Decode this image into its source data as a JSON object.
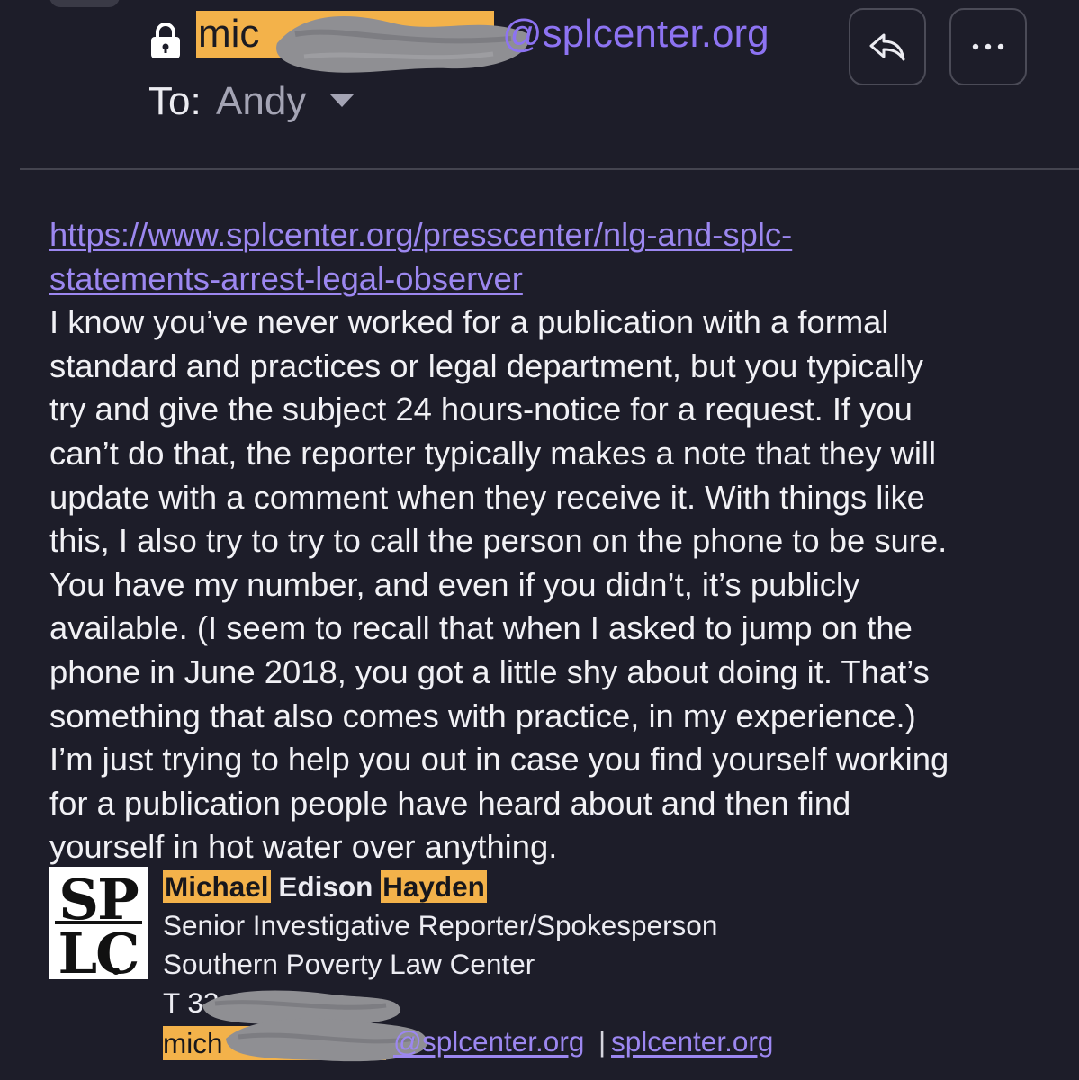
{
  "header": {
    "sender_prefix": "mic",
    "sender_domain": "@splcenter.org",
    "to_label": "To:",
    "to_name": "Andy",
    "reply_icon": "reply-arrow-icon",
    "more_icon": "ellipsis-icon",
    "lock_icon": "lock-icon"
  },
  "body": {
    "link_line1": "https://www.splcenter.org/presscenter/nlg-and-splc-",
    "link_line2": "statements-arrest-legal-observer",
    "lines": [
      "I know you’ve never worked for a publication with a formal",
      "standard and practices or legal department, but you typically",
      "try and give the subject 24 hours-notice for a request. If you",
      "can’t do that, the reporter typically makes a note that they will",
      "update with a comment when they receive it. With things like",
      "this, I also try to try to call the person on the phone to be sure.",
      "You have my number, and even if you didn’t, it’s publicly",
      "available. (I seem to recall that when I asked to jump on the",
      "phone in June 2018, you got a little shy about doing it. That’s",
      "something that also comes with practice, in my experience.)",
      "I’m just trying to help you out in case you find yourself working",
      "for a publication people have heard about and then find",
      "yourself in hot water over anything."
    ]
  },
  "signature": {
    "logo_top": "SP",
    "logo_bottom": "LC",
    "first_name": "Michael",
    "middle_name": "Edison",
    "last_name": "Hayden",
    "title": "Senior Investigative Reporter/Spokesperson",
    "organization": "Southern Poverty Law Center",
    "phone_prefix": "T 33",
    "email_prefix": "mich",
    "email_domain": "@splcenter.org",
    "separator": "|",
    "website": "splcenter.org"
  },
  "colors": {
    "background": "#1d1d29",
    "highlight": "#f3b24a",
    "link": "#9c87f0",
    "redaction": "#8f8f93"
  }
}
